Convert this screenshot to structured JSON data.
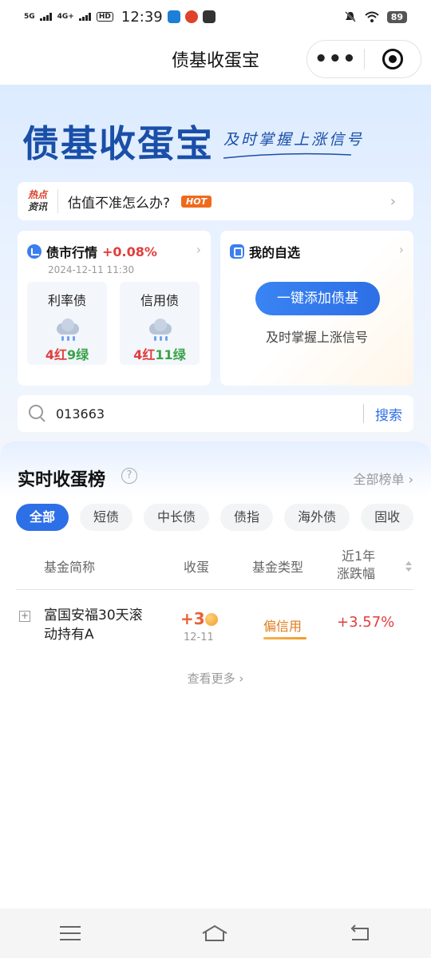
{
  "status_bar": {
    "net1": "5G",
    "net2": "4G+",
    "hd": "HD",
    "time": "12:39",
    "battery": "89"
  },
  "header": {
    "title": "债基收蛋宝"
  },
  "hero": {
    "logo": "债基收蛋宝",
    "slogan": "及时掌握上涨信号"
  },
  "news": {
    "tag_line1": "热点",
    "tag_line2": "资讯",
    "text": "估值不准怎么办?",
    "badge": "HOT"
  },
  "market": {
    "title": "债市行情",
    "change": "+0.08%",
    "datetime": "2024-12-11 11:30",
    "items": [
      {
        "name": "利率债",
        "red": "4红",
        "green": "9绿"
      },
      {
        "name": "信用债",
        "red": "4红",
        "green": "11绿"
      }
    ]
  },
  "watchlist": {
    "title": "我的自选",
    "button": "一键添加债基",
    "subtitle": "及时掌握上涨信号"
  },
  "search": {
    "value": "013663",
    "button": "搜索"
  },
  "ranking": {
    "title": "实时收蛋榜",
    "all_link": "全部榜单",
    "tabs": [
      {
        "label": "全部",
        "active": true
      },
      {
        "label": "短债",
        "active": false
      },
      {
        "label": "中长债",
        "active": false
      },
      {
        "label": "债指",
        "active": false
      },
      {
        "label": "海外债",
        "active": false
      },
      {
        "label": "固收",
        "active": false
      }
    ],
    "columns": {
      "name": "基金简称",
      "egg": "收蛋",
      "type": "基金类型",
      "return_line1": "近1年",
      "return_line2": "涨跌幅"
    },
    "rows": [
      {
        "name": "富国安福30天滚动持有A",
        "egg": "+3",
        "egg_date": "12-11",
        "type": "偏信用",
        "return": "+3.57%"
      }
    ],
    "more": "查看更多"
  }
}
